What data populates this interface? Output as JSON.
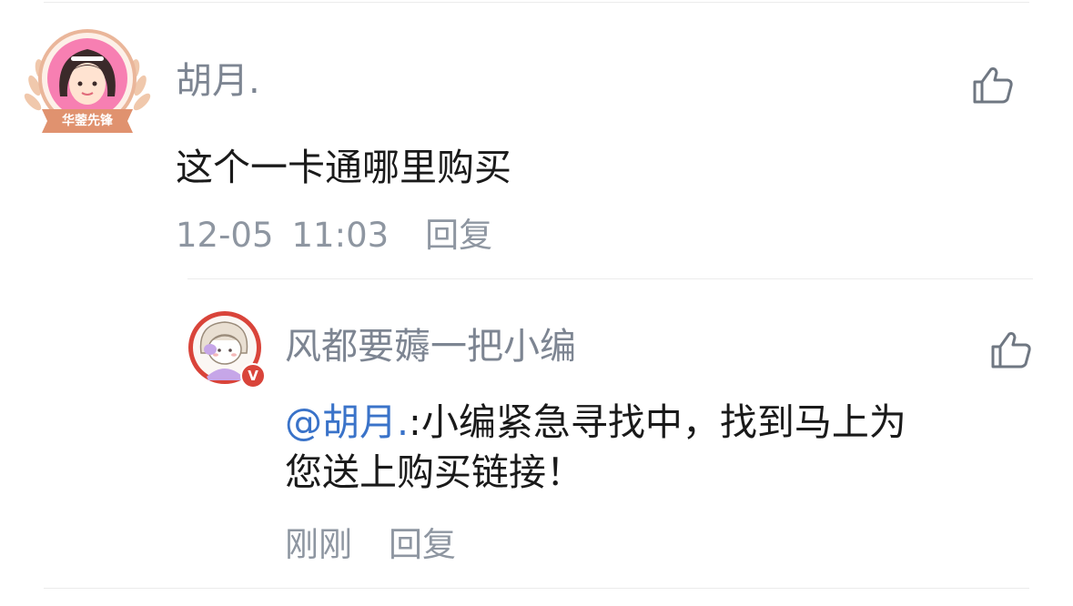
{
  "comment": {
    "author": "胡月.",
    "badge": "华蓥先锋",
    "text": "这个一卡通哪里购买",
    "date": "12-05",
    "time": "11:03",
    "reply_label": "回复"
  },
  "reply": {
    "author": "风都要薅一把小编",
    "verified_mark": "V",
    "mention": "@胡月.",
    "text_line1": ":小编紧急寻找中，找到马上为",
    "text_line2": "您送上购买链接！",
    "time": "刚刚",
    "reply_label": "回复"
  },
  "colors": {
    "name": "#7d8592",
    "meta": "#8e96a1",
    "mention": "#3a73c9",
    "badge": "#e0926f",
    "verified": "#d9443a"
  }
}
